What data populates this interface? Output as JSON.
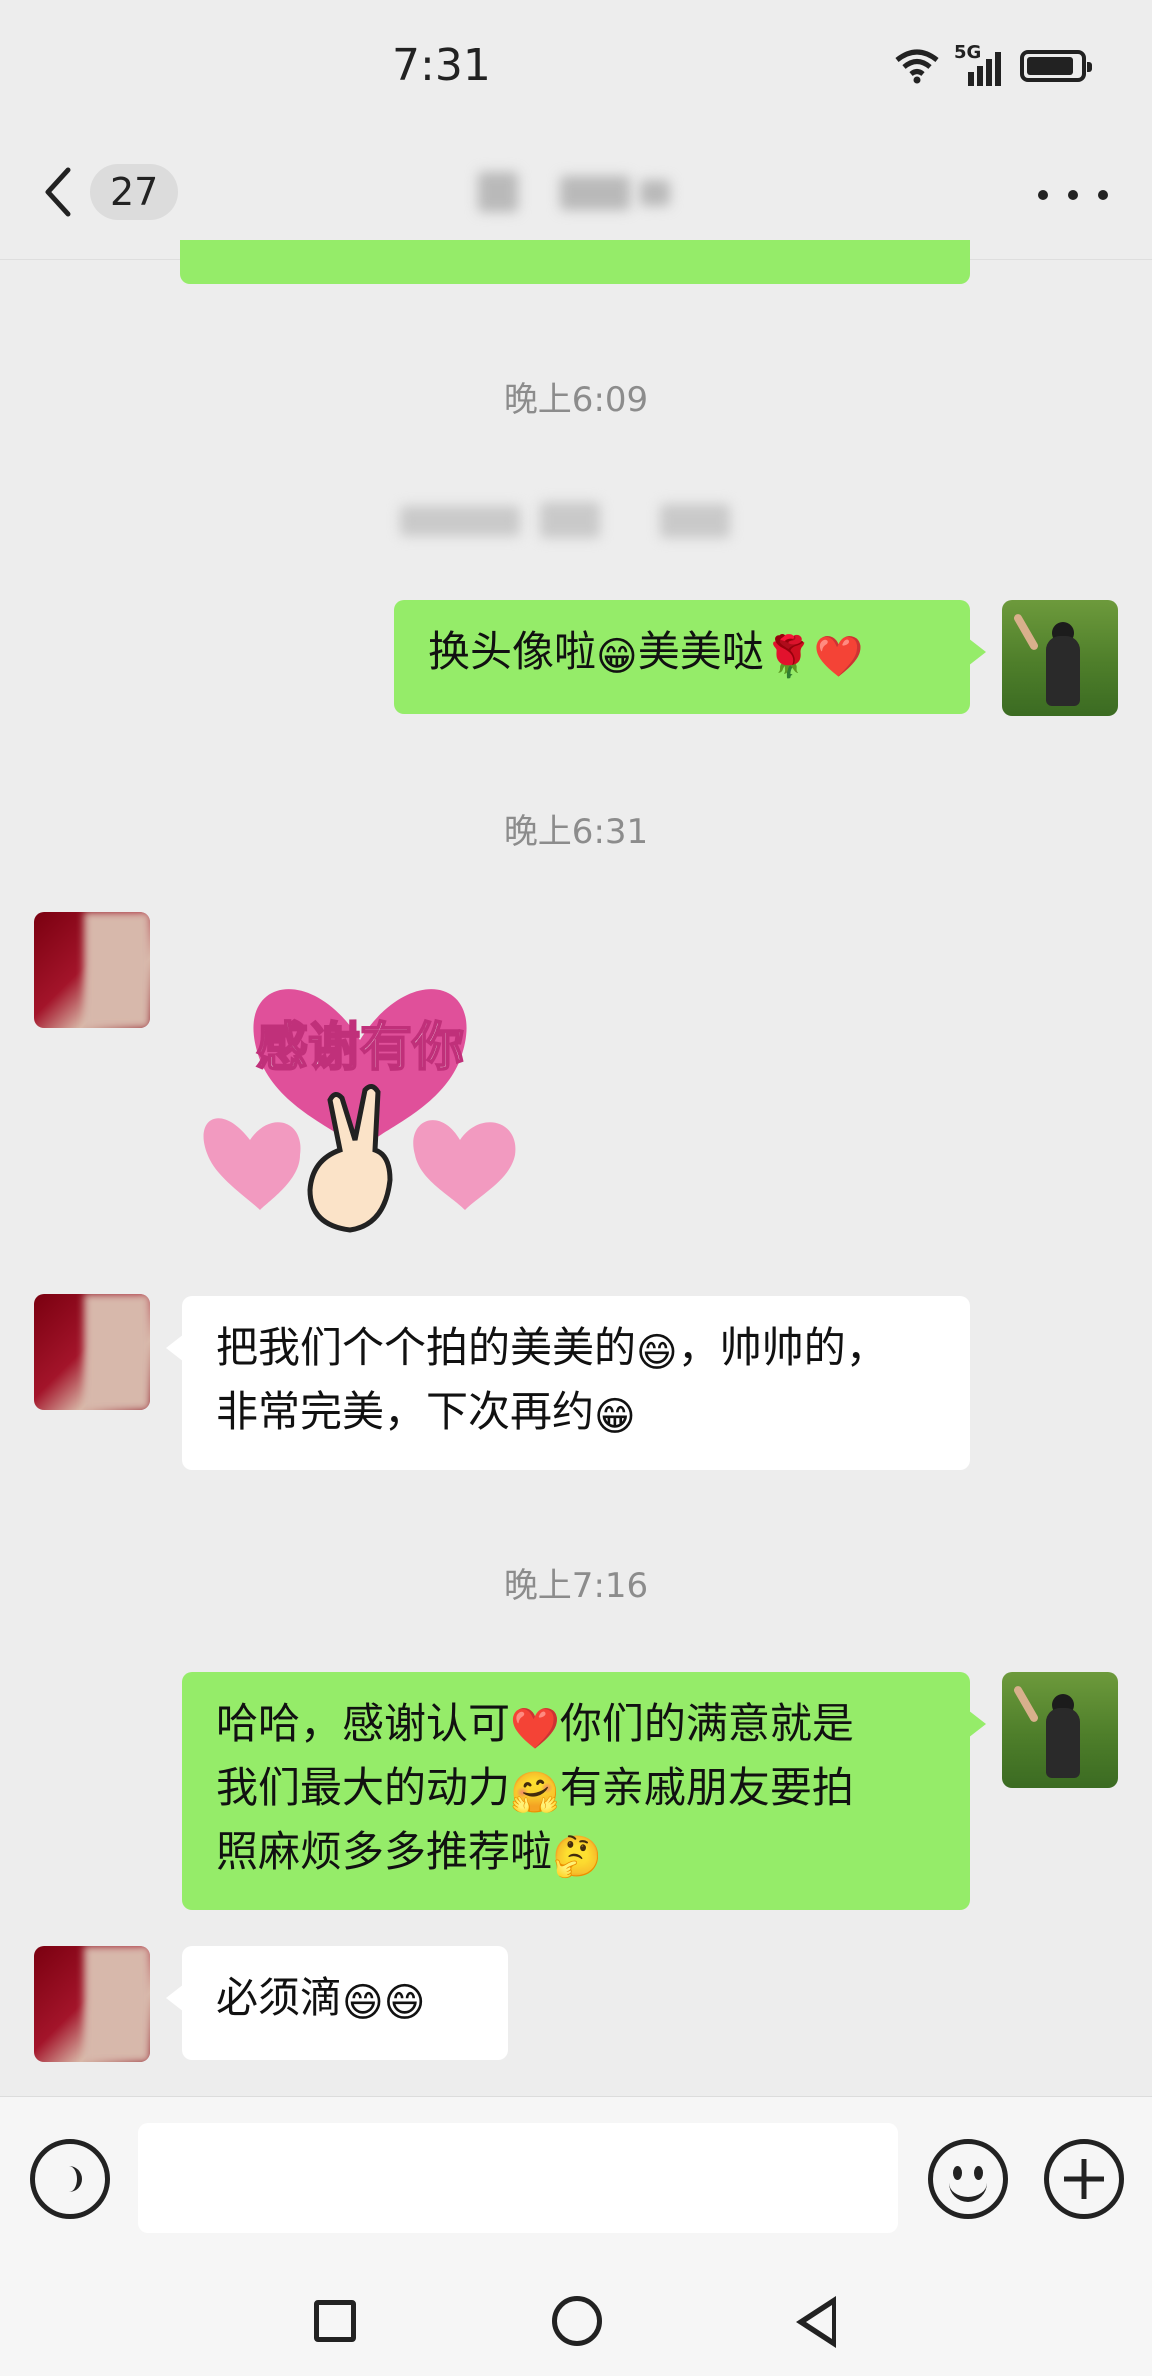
{
  "status_bar": {
    "time": "7:31",
    "network": "5G"
  },
  "nav": {
    "unread_count": "27"
  },
  "timestamps": {
    "t1": "晚上6:09",
    "t2": "晚上6:31",
    "t3": "晚上7:16"
  },
  "messages": [
    {
      "sender": "me",
      "text_a": "换头像啦",
      "emoji_a": "😁",
      "text_b": "美美哒",
      "emoji_b": "🌹",
      "emoji_c": "❤️"
    },
    {
      "sender": "them",
      "sticker_text": "感谢有你"
    },
    {
      "sender": "them",
      "line1_a": "把我们个个拍的美美的",
      "line1_emoji": "😄",
      "line1_b": "，帅帅的，",
      "line2_a": "非常完美，下次再约",
      "line2_emoji": "😁"
    },
    {
      "sender": "me",
      "line1_a": "哈哈，感谢认可",
      "line1_emoji": "❤️",
      "line1_b": "你们的满意就是",
      "line2_a": "我们最大的动力",
      "line2_emoji": "🤗",
      "line2_b": "有亲戚朋友要拍",
      "line3_a": "照麻烦多多推荐啦",
      "line3_emoji": "🤔"
    },
    {
      "sender": "them",
      "text": "必须滴",
      "emoji_a": "😄",
      "emoji_b": "😄"
    }
  ],
  "input_bar": {
    "text_value": ""
  },
  "icons": {
    "voice": "voice-icon",
    "emoji": "emoji-icon",
    "plus": "plus-icon",
    "back": "chevron-left-icon",
    "more": "more-icon"
  },
  "colors": {
    "my_bubble": "#95ec69",
    "their_bubble": "#ffffff",
    "background": "#ededed"
  }
}
